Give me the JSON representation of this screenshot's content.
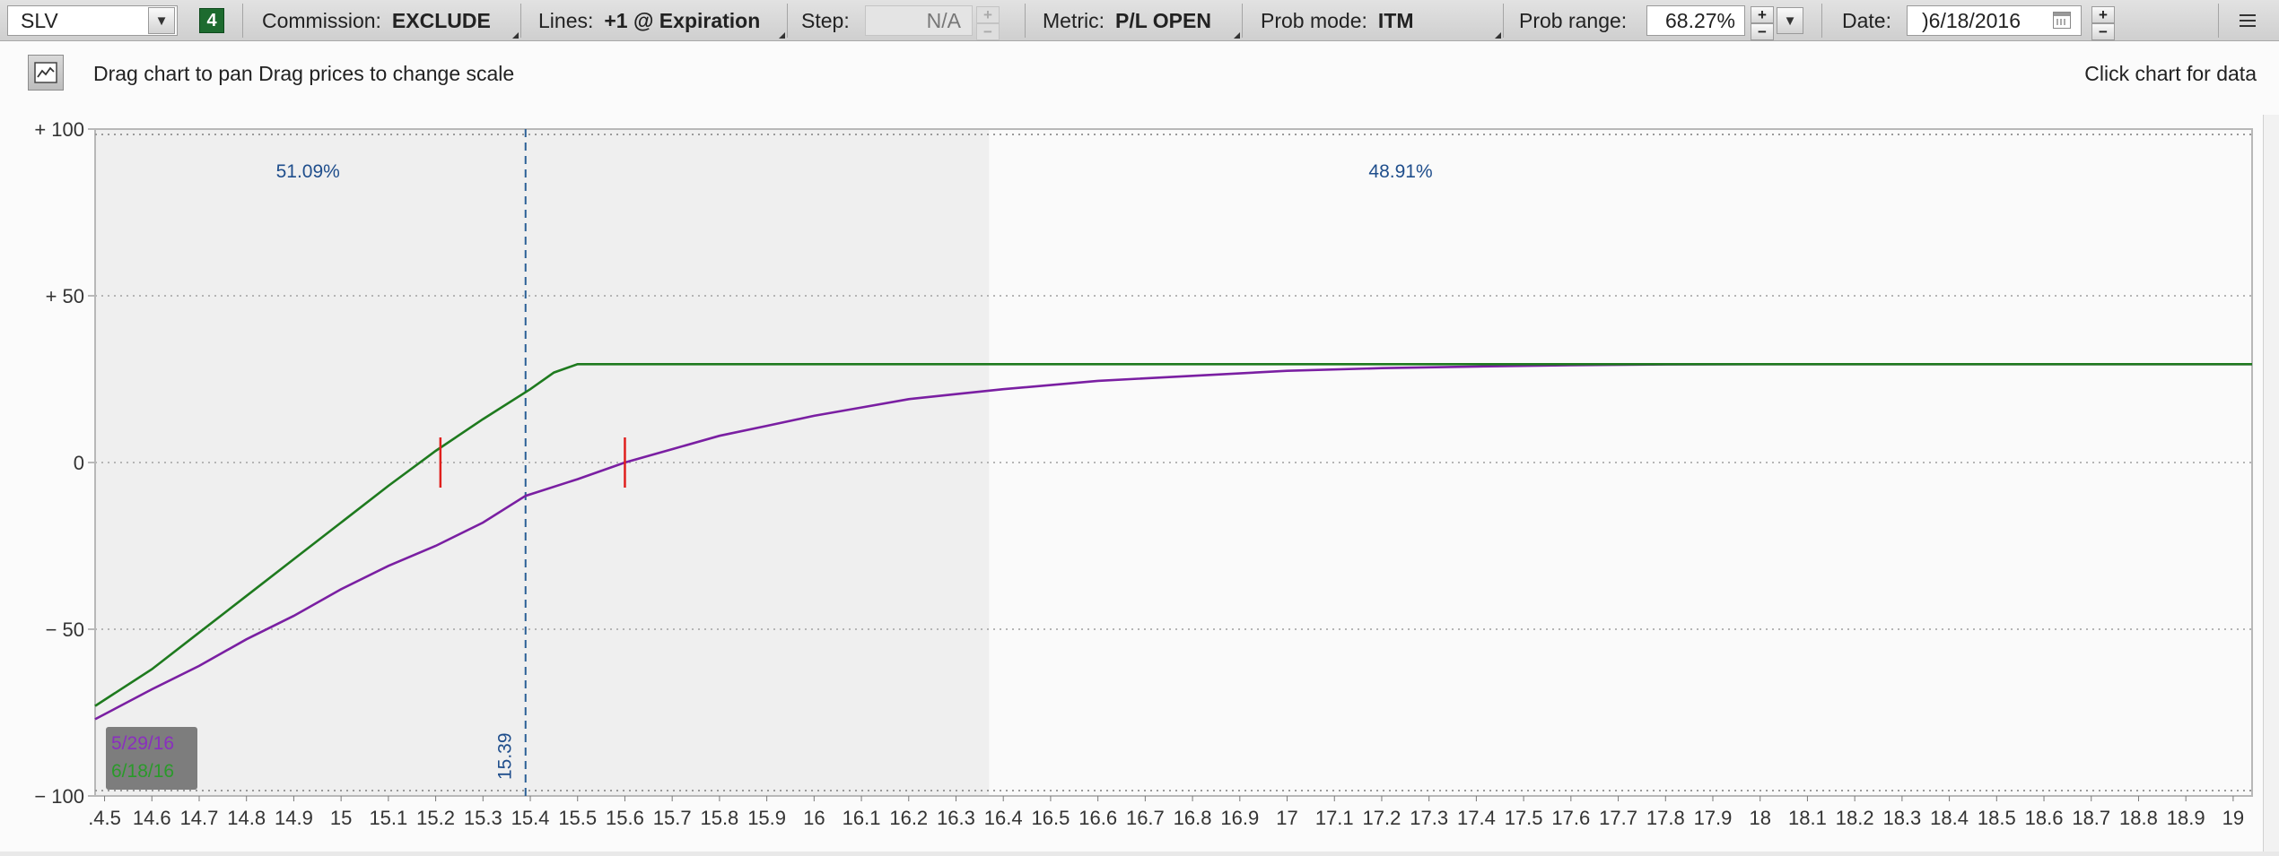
{
  "toolbar": {
    "symbol": "SLV",
    "badge": "4",
    "commission_label": "Commission:",
    "commission_value": "EXCLUDE",
    "lines_label": "Lines:",
    "lines_value": "+1 @ Expiration",
    "step_label": "Step:",
    "step_value": "N/A",
    "metric_label": "Metric:",
    "metric_value": "P/L OPEN",
    "probmode_label": "Prob mode:",
    "probmode_value": "ITM",
    "probrange_label": "Prob range:",
    "probrange_value": "68.27%",
    "date_label": "Date:",
    "date_value": ")6/18/2016",
    "icons": {
      "symbol_dropdown": "chevron-down-icon",
      "spinner": "plus-minus-icon",
      "calendar": "calendar-icon",
      "menu": "menu-icon"
    }
  },
  "subbar": {
    "hint_left": "Drag chart to pan Drag prices to change scale",
    "hint_right": "Click chart for data",
    "chart_icon": "chart-icon"
  },
  "chart_data": {
    "type": "line",
    "title": "",
    "xlabel": "",
    "ylabel": "",
    "xlim": [
      14.48,
      19.04
    ],
    "ylim": [
      -100,
      100
    ],
    "grid": true,
    "x_ticks": [
      ".4.5",
      "14.6",
      "14.7",
      "14.8",
      "14.9",
      "15",
      "15.1",
      "15.2",
      "15.3",
      "15.4",
      "15.5",
      "15.6",
      "15.7",
      "15.8",
      "15.9",
      "16",
      "16.1",
      "16.2",
      "16.3",
      "16.4",
      "16.5",
      "16.6",
      "16.7",
      "16.8",
      "16.9",
      "17",
      "17.1",
      "17.2",
      "17.3",
      "17.4",
      "17.5",
      "17.6",
      "17.7",
      "17.8",
      "17.9",
      "18",
      "18.1",
      "18.2",
      "18.3",
      "18.4",
      "18.5",
      "18.6",
      "18.7",
      "18.8",
      "18.9",
      "19"
    ],
    "x_tick_values": [
      14.5,
      14.6,
      14.7,
      14.8,
      14.9,
      15,
      15.1,
      15.2,
      15.3,
      15.4,
      15.5,
      15.6,
      15.7,
      15.8,
      15.9,
      16,
      16.1,
      16.2,
      16.3,
      16.4,
      16.5,
      16.6,
      16.7,
      16.8,
      16.9,
      17,
      17.1,
      17.2,
      17.3,
      17.4,
      17.5,
      17.6,
      17.7,
      17.8,
      17.9,
      18,
      18.1,
      18.2,
      18.3,
      18.4,
      18.5,
      18.6,
      18.7,
      18.8,
      18.9,
      19
    ],
    "y_ticks": [
      {
        "value": 100,
        "label": "+ 100"
      },
      {
        "value": 50,
        "label": "+ 50"
      },
      {
        "value": 0,
        "label": "0"
      },
      {
        "value": -50,
        "label": "− 50"
      },
      {
        "value": -100,
        "label": "− 100"
      }
    ],
    "series": [
      {
        "name": "5/29/16",
        "color": "#7a1fa2",
        "x": [
          14.48,
          14.6,
          14.7,
          14.8,
          14.9,
          15.0,
          15.1,
          15.2,
          15.3,
          15.39,
          15.5,
          15.6,
          15.7,
          15.8,
          15.9,
          16.0,
          16.1,
          16.2,
          16.3,
          16.4,
          16.6,
          16.8,
          17.0,
          17.2,
          17.4,
          17.6,
          17.8,
          18.0,
          18.5,
          19.04
        ],
        "y": [
          -77,
          -68,
          -61,
          -53,
          -46,
          -38,
          -31,
          -25,
          -18,
          -10,
          -5,
          0,
          4,
          8,
          11,
          14,
          16.5,
          19,
          20.5,
          22,
          24.5,
          26,
          27.5,
          28.3,
          28.8,
          29.2,
          29.4,
          29.5,
          29.5,
          29.5
        ]
      },
      {
        "name": "6/18/16",
        "color": "#1e7a1e",
        "x": [
          14.48,
          14.6,
          14.7,
          14.8,
          14.9,
          15.0,
          15.1,
          15.2,
          15.3,
          15.4,
          15.45,
          15.5,
          16.0,
          17.0,
          18.0,
          19.04
        ],
        "y": [
          -73,
          -62,
          -51,
          -40,
          -29,
          -18,
          -7,
          3.5,
          13,
          22,
          27,
          29.5,
          29.5,
          29.5,
          29.5,
          29.5
        ]
      }
    ],
    "current_price": 15.39,
    "current_price_label": "15.39",
    "shaded_region": [
      14.48,
      16.37
    ],
    "probabilities": [
      {
        "label": "51.09%",
        "x": 14.93
      },
      {
        "label": "48.91%",
        "x": 17.24
      }
    ],
    "breakevens": [
      15.21,
      15.6
    ],
    "legend": [
      "5/29/16",
      "6/18/16"
    ],
    "legend_position": "bottom-left"
  }
}
